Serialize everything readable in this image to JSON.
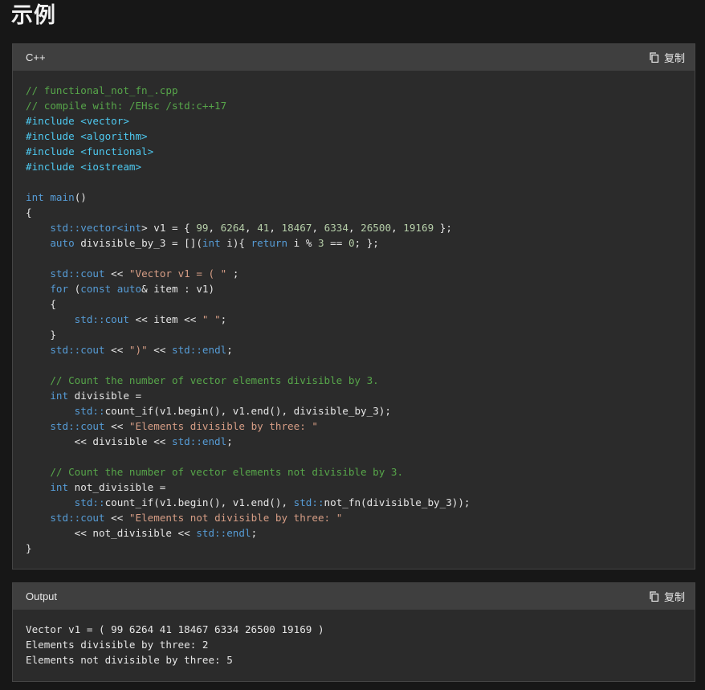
{
  "page": {
    "title": "示例"
  },
  "code_block": {
    "language": "C++",
    "copy_label": "复制",
    "lines": [
      [
        {
          "t": "// functional_not_fn_.cpp",
          "c": "c"
        }
      ],
      [
        {
          "t": "// compile with: /EHsc /std:c++17",
          "c": "c"
        }
      ],
      [
        {
          "t": "#include <vector>",
          "c": "pp"
        }
      ],
      [
        {
          "t": "#include <algorithm>",
          "c": "pp"
        }
      ],
      [
        {
          "t": "#include <functional>",
          "c": "pp"
        }
      ],
      [
        {
          "t": "#include <iostream>",
          "c": "pp"
        }
      ],
      [],
      [
        {
          "t": "int",
          "c": "k"
        },
        {
          "t": " "
        },
        {
          "t": "main",
          "c": "k"
        },
        {
          "t": "()"
        }
      ],
      [
        {
          "t": "{"
        }
      ],
      [
        {
          "t": "    std::",
          "c": "k"
        },
        {
          "t": "vector<",
          "c": "k"
        },
        {
          "t": "int",
          "c": "k"
        },
        {
          "t": "> v1 = { "
        },
        {
          "t": "99",
          "c": "n"
        },
        {
          "t": ", "
        },
        {
          "t": "6264",
          "c": "n"
        },
        {
          "t": ", "
        },
        {
          "t": "41",
          "c": "n"
        },
        {
          "t": ", "
        },
        {
          "t": "18467",
          "c": "n"
        },
        {
          "t": ", "
        },
        {
          "t": "6334",
          "c": "n"
        },
        {
          "t": ", "
        },
        {
          "t": "26500",
          "c": "n"
        },
        {
          "t": ", "
        },
        {
          "t": "19169",
          "c": "n"
        },
        {
          "t": " };"
        }
      ],
      [
        {
          "t": "    auto",
          "c": "k"
        },
        {
          "t": " divisible_by_3 = []("
        },
        {
          "t": "int",
          "c": "k"
        },
        {
          "t": " i){ "
        },
        {
          "t": "return",
          "c": "k"
        },
        {
          "t": " i % "
        },
        {
          "t": "3",
          "c": "n"
        },
        {
          "t": " == "
        },
        {
          "t": "0",
          "c": "n"
        },
        {
          "t": "; };"
        }
      ],
      [],
      [
        {
          "t": "    std::cout",
          "c": "k"
        },
        {
          "t": " << "
        },
        {
          "t": "\"Vector v1 = ( \"",
          "c": "s"
        },
        {
          "t": " ;"
        }
      ],
      [
        {
          "t": "    for",
          "c": "k"
        },
        {
          "t": " ("
        },
        {
          "t": "const auto",
          "c": "k"
        },
        {
          "t": "& item : v1)"
        }
      ],
      [
        {
          "t": "    {"
        }
      ],
      [
        {
          "t": "        std::cout",
          "c": "k"
        },
        {
          "t": " << item << "
        },
        {
          "t": "\" \"",
          "c": "s"
        },
        {
          "t": ";"
        }
      ],
      [
        {
          "t": "    }"
        }
      ],
      [
        {
          "t": "    std::cout",
          "c": "k"
        },
        {
          "t": " << "
        },
        {
          "t": "\")\"",
          "c": "s"
        },
        {
          "t": " << "
        },
        {
          "t": "std::endl",
          "c": "k"
        },
        {
          "t": ";"
        }
      ],
      [],
      [
        {
          "t": "    // Count the number of vector elements divisible by 3.",
          "c": "c"
        }
      ],
      [
        {
          "t": "    int",
          "c": "k"
        },
        {
          "t": " divisible ="
        }
      ],
      [
        {
          "t": "        std::",
          "c": "k"
        },
        {
          "t": "count_if(v1.begin(), v1.end(), divisible_by_3);"
        }
      ],
      [
        {
          "t": "    std::cout",
          "c": "k"
        },
        {
          "t": " << "
        },
        {
          "t": "\"Elements divisible by three: \"",
          "c": "s"
        }
      ],
      [
        {
          "t": "        << divisible << "
        },
        {
          "t": "std::endl",
          "c": "k"
        },
        {
          "t": ";"
        }
      ],
      [],
      [
        {
          "t": "    // Count the number of vector elements not divisible by 3.",
          "c": "c"
        }
      ],
      [
        {
          "t": "    int",
          "c": "k"
        },
        {
          "t": " not_divisible ="
        }
      ],
      [
        {
          "t": "        std::",
          "c": "k"
        },
        {
          "t": "count_if(v1.begin(), v1.end(), "
        },
        {
          "t": "std::",
          "c": "k"
        },
        {
          "t": "not_fn(divisible_by_3));"
        }
      ],
      [
        {
          "t": "    std::cout",
          "c": "k"
        },
        {
          "t": " << "
        },
        {
          "t": "\"Elements not divisible by three: \"",
          "c": "s"
        }
      ],
      [
        {
          "t": "        << not_divisible << "
        },
        {
          "t": "std::endl",
          "c": "k"
        },
        {
          "t": ";"
        }
      ],
      [
        {
          "t": "}"
        }
      ]
    ]
  },
  "output_block": {
    "language": "Output",
    "copy_label": "复制",
    "lines": [
      [
        {
          "t": "Vector v1 = ( 99 6264 41 18467 6334 26500 19169 )"
        }
      ],
      [
        {
          "t": "Elements divisible by three: 2"
        }
      ],
      [
        {
          "t": "Elements not divisible by three: 5"
        }
      ]
    ]
  },
  "colors": {
    "background": "#171717",
    "block_background": "#2b2b2b",
    "header_background": "#3f3f3f",
    "comment": "#57a64a",
    "keyword": "#569cd6",
    "preprocessor": "#4ec9f0",
    "string": "#d69d85",
    "number": "#b5cea8"
  },
  "icons": {
    "copy": "copy-icon"
  }
}
